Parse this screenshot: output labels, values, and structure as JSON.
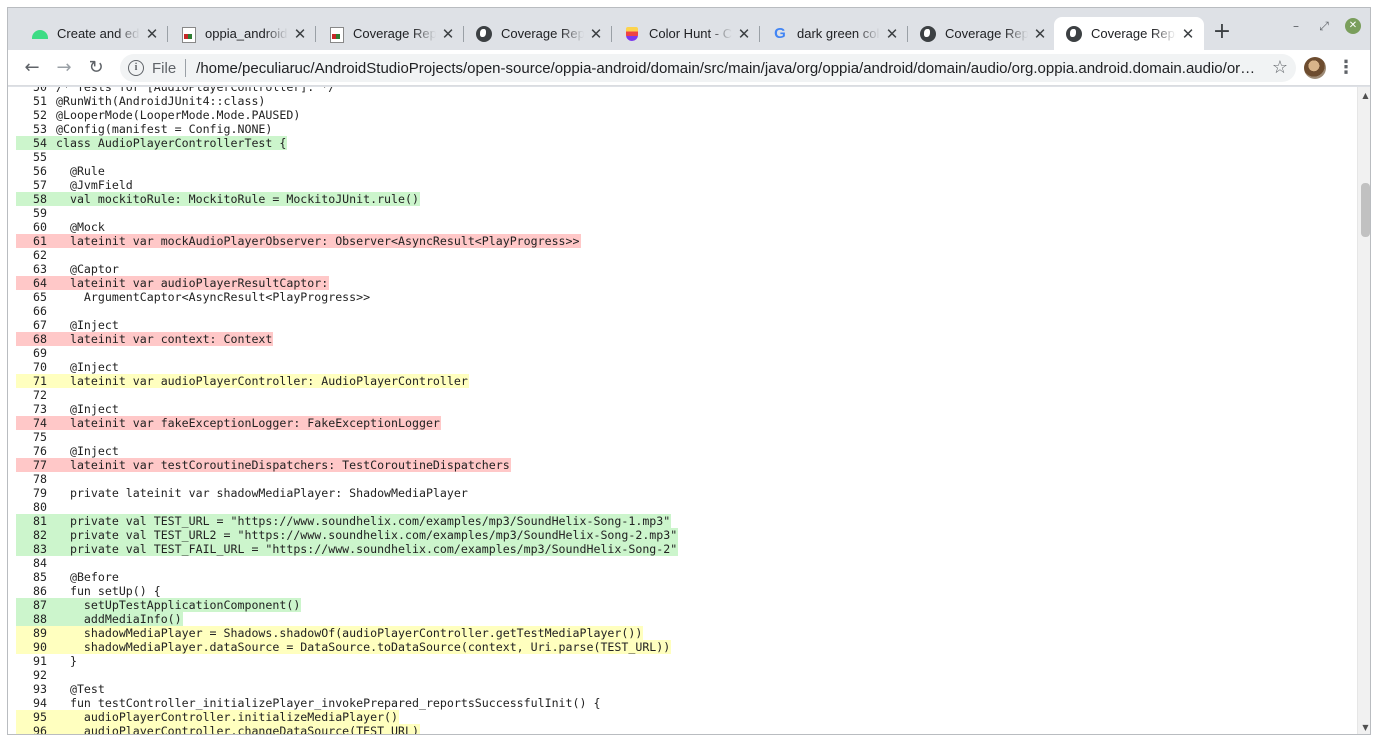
{
  "tabs": [
    {
      "title": "Create and edit",
      "icon": "android-icon",
      "active": false
    },
    {
      "title": "oppia_android",
      "icon": "document-icon",
      "active": false
    },
    {
      "title": "Coverage Report",
      "icon": "document-icon",
      "active": false
    },
    {
      "title": "Coverage Report",
      "icon": "globe-icon",
      "active": false
    },
    {
      "title": "Color Hunt - Color Palettes",
      "icon": "colorhunt-icon",
      "active": false
    },
    {
      "title": "dark green color",
      "icon": "google-icon",
      "active": false
    },
    {
      "title": "Coverage Report",
      "icon": "globe-icon",
      "active": false
    },
    {
      "title": "Coverage Report",
      "icon": "globe-icon",
      "active": true
    }
  ],
  "toolbar": {
    "back": "←",
    "forward": "→",
    "reload": "↻",
    "scheme_label": "File",
    "url": "/home/peculiaruc/AndroidStudioProjects/open-source/oppia-android/domain/src/main/java/org/oppia/android/domain/audio/org.oppia.android.domain.audio/org.oppia.android.domain.audio.AudioPlayerControllerTest.kt.html",
    "star": "☆",
    "menu": "⋮",
    "new_tab": "+"
  },
  "window_controls": {
    "minimize": "–",
    "restore": "⤢",
    "close": "✕"
  },
  "colors": {
    "covered": "#ccf5cc",
    "missed": "#ffc8c8",
    "partial": "#ffffbf"
  },
  "code_lines": [
    {
      "n": "50",
      "t": "/* Tests for [AudioPlayerController]. */",
      "s": "none"
    },
    {
      "n": "51",
      "t": "@RunWith(AndroidJUnit4::class)",
      "s": "none"
    },
    {
      "n": "52",
      "t": "@LooperMode(LooperMode.Mode.PAUSED)",
      "s": "none"
    },
    {
      "n": "53",
      "t": "@Config(manifest = Config.NONE)",
      "s": "none"
    },
    {
      "n": "54",
      "t": "class AudioPlayerControllerTest {",
      "s": "covered"
    },
    {
      "n": "55",
      "t": "",
      "s": "none"
    },
    {
      "n": "56",
      "t": "  @Rule",
      "s": "none"
    },
    {
      "n": "57",
      "t": "  @JvmField",
      "s": "none"
    },
    {
      "n": "58",
      "t": "  val mockitoRule: MockitoRule = MockitoJUnit.rule()",
      "s": "covered"
    },
    {
      "n": "59",
      "t": "",
      "s": "none"
    },
    {
      "n": "60",
      "t": "  @Mock",
      "s": "none"
    },
    {
      "n": "61",
      "t": "  lateinit var mockAudioPlayerObserver: Observer<AsyncResult<PlayProgress>>",
      "s": "missed"
    },
    {
      "n": "62",
      "t": "",
      "s": "none"
    },
    {
      "n": "63",
      "t": "  @Captor",
      "s": "none"
    },
    {
      "n": "64",
      "t": "  lateinit var audioPlayerResultCaptor:",
      "s": "missed"
    },
    {
      "n": "65",
      "t": "    ArgumentCaptor<AsyncResult<PlayProgress>>",
      "s": "none"
    },
    {
      "n": "66",
      "t": "",
      "s": "none"
    },
    {
      "n": "67",
      "t": "  @Inject",
      "s": "none"
    },
    {
      "n": "68",
      "t": "  lateinit var context: Context",
      "s": "missed"
    },
    {
      "n": "69",
      "t": "",
      "s": "none"
    },
    {
      "n": "70",
      "t": "  @Inject",
      "s": "none"
    },
    {
      "n": "71",
      "t": "  lateinit var audioPlayerController: AudioPlayerController",
      "s": "partial"
    },
    {
      "n": "72",
      "t": "",
      "s": "none"
    },
    {
      "n": "73",
      "t": "  @Inject",
      "s": "none"
    },
    {
      "n": "74",
      "t": "  lateinit var fakeExceptionLogger: FakeExceptionLogger",
      "s": "missed"
    },
    {
      "n": "75",
      "t": "",
      "s": "none"
    },
    {
      "n": "76",
      "t": "  @Inject",
      "s": "none"
    },
    {
      "n": "77",
      "t": "  lateinit var testCoroutineDispatchers: TestCoroutineDispatchers",
      "s": "missed"
    },
    {
      "n": "78",
      "t": "",
      "s": "none"
    },
    {
      "n": "79",
      "t": "  private lateinit var shadowMediaPlayer: ShadowMediaPlayer",
      "s": "none"
    },
    {
      "n": "80",
      "t": "",
      "s": "none"
    },
    {
      "n": "81",
      "t": "  private val TEST_URL = \"https://www.soundhelix.com/examples/mp3/SoundHelix-Song-1.mp3\"",
      "s": "covered"
    },
    {
      "n": "82",
      "t": "  private val TEST_URL2 = \"https://www.soundhelix.com/examples/mp3/SoundHelix-Song-2.mp3\"",
      "s": "covered"
    },
    {
      "n": "83",
      "t": "  private val TEST_FAIL_URL = \"https://www.soundhelix.com/examples/mp3/SoundHelix-Song-2\"",
      "s": "covered"
    },
    {
      "n": "84",
      "t": "",
      "s": "none"
    },
    {
      "n": "85",
      "t": "  @Before",
      "s": "none"
    },
    {
      "n": "86",
      "t": "  fun setUp() {",
      "s": "none"
    },
    {
      "n": "87",
      "t": "    setUpTestApplicationComponent()",
      "s": "covered"
    },
    {
      "n": "88",
      "t": "    addMediaInfo()",
      "s": "covered"
    },
    {
      "n": "89",
      "t": "    shadowMediaPlayer = Shadows.shadowOf(audioPlayerController.getTestMediaPlayer())",
      "s": "partial"
    },
    {
      "n": "90",
      "t": "    shadowMediaPlayer.dataSource = DataSource.toDataSource(context, Uri.parse(TEST_URL))",
      "s": "partial"
    },
    {
      "n": "91",
      "t": "  }",
      "s": "none"
    },
    {
      "n": "92",
      "t": "",
      "s": "none"
    },
    {
      "n": "93",
      "t": "  @Test",
      "s": "none"
    },
    {
      "n": "94",
      "t": "  fun testController_initializePlayer_invokePrepared_reportsSuccessfulInit() {",
      "s": "none"
    },
    {
      "n": "95",
      "t": "    audioPlayerController.initializeMediaPlayer()",
      "s": "partial"
    },
    {
      "n": "96",
      "t": "    audioPlayerController.changeDataSource(TEST_URL)",
      "s": "partial"
    }
  ]
}
